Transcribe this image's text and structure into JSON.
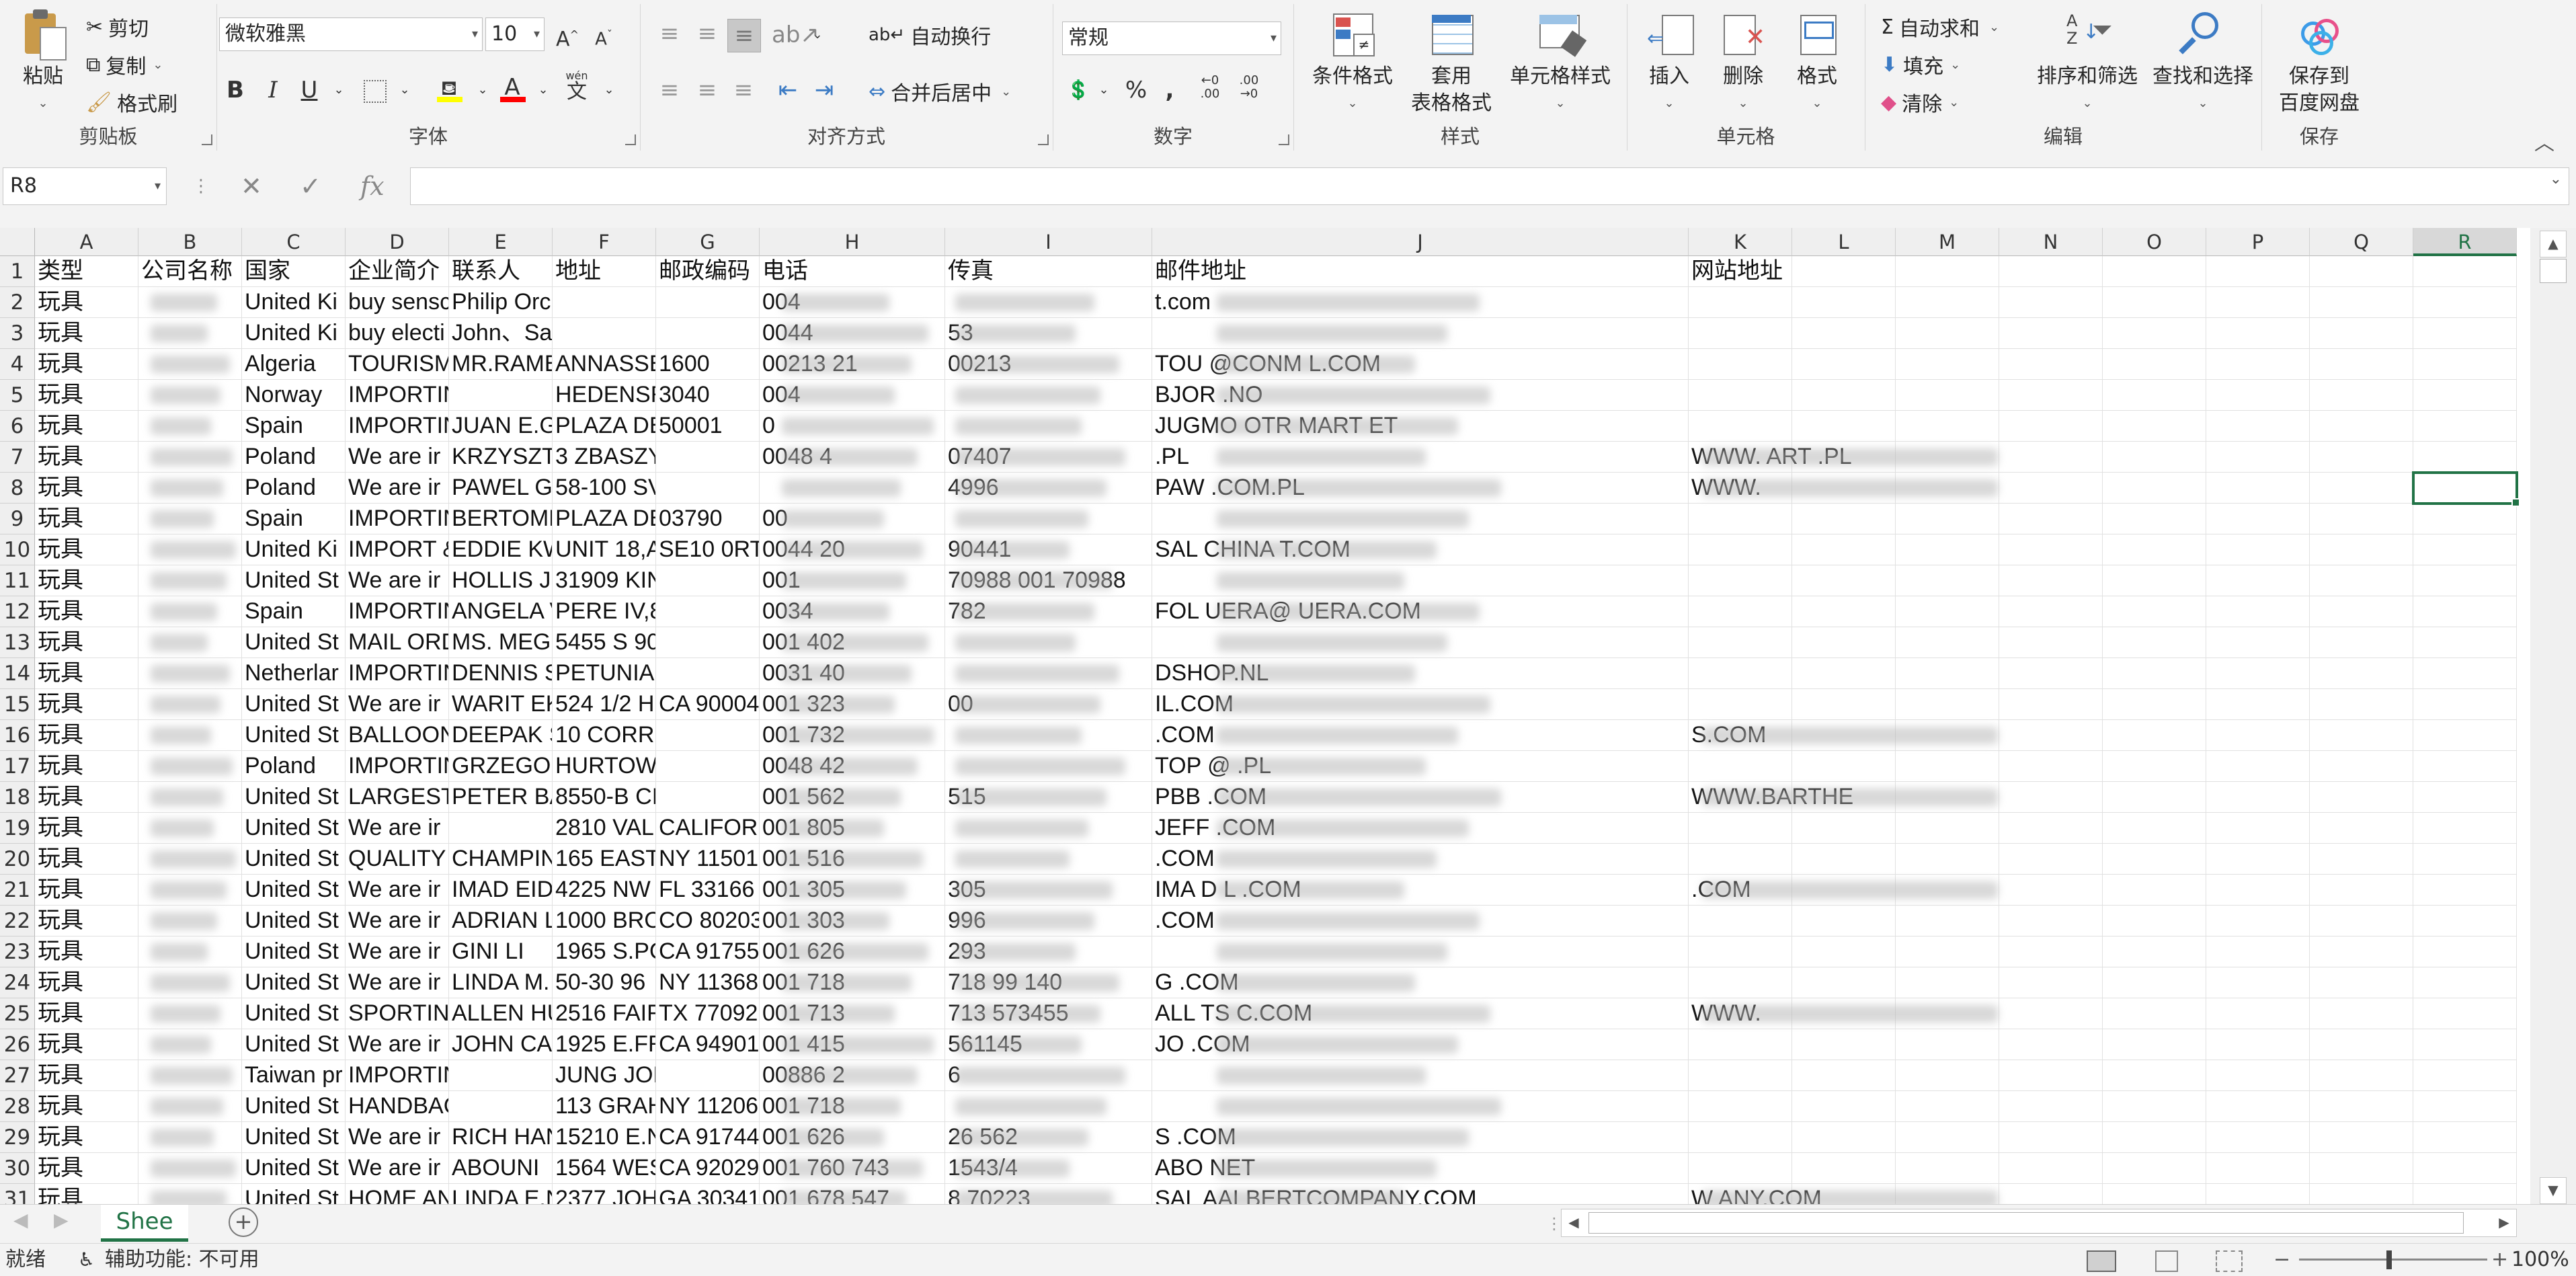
{
  "ribbon": {
    "clipboard": {
      "group_label": "剪贴板",
      "paste": "粘贴",
      "cut": "剪切",
      "copy": "复制",
      "format_painter": "格式刷"
    },
    "font": {
      "group_label": "字体",
      "font_name": "微软雅黑",
      "font_size": "10",
      "bold": "B",
      "italic": "I",
      "underline": "U",
      "grow": "A",
      "shrink": "A",
      "phonetic": "wén"
    },
    "alignment": {
      "group_label": "对齐方式",
      "wrap_text": "自动换行",
      "merge_center": "合并后居中"
    },
    "number": {
      "group_label": "数字",
      "format": "常规",
      "percent": "%",
      "comma": ","
    },
    "styles": {
      "group_label": "样式",
      "conditional": "条件格式",
      "table_format_1": "套用",
      "table_format_2": "表格格式",
      "cell_styles": "单元格样式"
    },
    "cells": {
      "group_label": "单元格",
      "insert": "插入",
      "delete": "删除",
      "format": "格式"
    },
    "editing": {
      "group_label": "编辑",
      "autosum": "自动求和",
      "fill": "填充",
      "clear": "清除",
      "sort_filter": "排序和筛选",
      "find_select": "查找和选择"
    },
    "save": {
      "group_label": "保存",
      "save_to_1": "保存到",
      "save_to_2": "百度网盘"
    }
  },
  "formula_bar": {
    "name_box": "R8",
    "fx": "fx",
    "content": ""
  },
  "columns": [
    "A",
    "B",
    "C",
    "D",
    "E",
    "F",
    "G",
    "H",
    "I",
    "J",
    "K",
    "L",
    "M",
    "N",
    "O",
    "P",
    "Q",
    "R"
  ],
  "selected_column": "R",
  "active_cell": "R8",
  "header_row": [
    "类型",
    "公司名称",
    "国家",
    "企业简介",
    "联系人",
    "地址",
    "邮政编码",
    "电话",
    "传真",
    "邮件地址",
    "网站地址"
  ],
  "rows": [
    {
      "n": "2",
      "A": "玩具",
      "C": "United Ki",
      "D": "buy sensc",
      "E": "Philip Orchard",
      "H": "004",
      "J": "t.com"
    },
    {
      "n": "3",
      "A": "玩具",
      "C": "United Ki",
      "D": "buy electi",
      "E": "John、Sandra Emms",
      "H": "0044",
      "I": "53",
      "J": ""
    },
    {
      "n": "4",
      "A": "玩具",
      "C": "Algeria",
      "D": "TOURISM",
      "E": "MR.RAME",
      "F": "ANNASSE",
      "G": "1600",
      "H": "00213 21",
      "I": "00213",
      "J": "TOU   @CONM   L.COM"
    },
    {
      "n": "5",
      "A": "玩具",
      "C": "Norway",
      "D": "IMPORTIN",
      "F": "HEDENSR",
      "G": "3040",
      "H": "004",
      "J": "BJOR                 .NO"
    },
    {
      "n": "6",
      "A": "玩具",
      "C": "Spain",
      "D": "IMPORTIN",
      "E": "JUAN E.G",
      "F": "PLAZA DE",
      "G": "50001",
      "H": "0",
      "J": "JUGMO  OTR    MART   ET"
    },
    {
      "n": "7",
      "A": "玩具",
      "C": "Poland",
      "D": "We are ir",
      "E": "KRZYSZT(",
      "F": "3 ZBASZY",
      "H": "0048 4",
      "I": "07407",
      "J": "                .PL",
      "K": "WWW.    ART    .PL"
    },
    {
      "n": "8",
      "A": "玩具",
      "C": "Poland",
      "D": "We are ir",
      "E": "PAWEL G",
      "F": "58-100 SV",
      "I": "4996",
      "J": "PAW        .COM.PL",
      "K": "WWW."
    },
    {
      "n": "9",
      "A": "玩具",
      "C": "Spain",
      "D": "IMPORTIN",
      "E": "BERTOME",
      "F": "PLAZA DE",
      "G": "03790",
      "H": "00",
      "J": ""
    },
    {
      "n": "10",
      "A": "玩具",
      "C": "United Ki",
      "D": "IMPORT &",
      "E": "EDDIE KW",
      "F": "UNIT 18,A",
      "G": "SE10 0RT",
      "H": "0044 20",
      "I": "90441",
      "J": "SAL    CHINA    T.COM"
    },
    {
      "n": "11",
      "A": "玩具",
      "C": "United St",
      "D": "We are ir",
      "E": "HOLLIS J.",
      "F": "31909 KIN",
      "H": "001",
      "I": "70988  001   70988",
      "J": ""
    },
    {
      "n": "12",
      "A": "玩具",
      "C": "Spain",
      "D": "IMPORTIN",
      "E": "ANGELA V",
      "F": "PERE IV,8",
      "H": "0034",
      "I": "782",
      "J": "FOL  UERA@     UERA.COM"
    },
    {
      "n": "13",
      "A": "玩具",
      "C": "United St",
      "D": "MAIL ORD",
      "E": "MS. MEG",
      "F": "5455 S 90",
      "H": "001 402",
      "J": ""
    },
    {
      "n": "14",
      "A": "玩具",
      "C": "Netherlar",
      "D": "IMPORTIN",
      "E": "DENNIS S",
      "F": "PETUNIAI",
      "H": "0031 40",
      "I": "",
      "J": "              DSHOP.NL"
    },
    {
      "n": "15",
      "A": "玩具",
      "C": "United St",
      "D": "We are ir",
      "E": "WARIT EK",
      "F": "524 1/2 H",
      "G": "CA 90004",
      "H": "001 323",
      "I": "00",
      "J": "                  IL.COM"
    },
    {
      "n": "16",
      "A": "玩具",
      "C": "United St",
      "D": "BALLOON",
      "E": "DEEPAK S",
      "F": "10 CORRI",
      "H": "001 732",
      "J": "                   .COM",
      "K": "                          S.COM"
    },
    {
      "n": "17",
      "A": "玩具",
      "C": "Poland",
      "D": "IMPORTIN",
      "E": "GRZEGOR",
      "F": "HURTOW",
      "H": "0048 42",
      "J": "TOP    @       .PL"
    },
    {
      "n": "18",
      "A": "玩具",
      "C": "United St",
      "D": "LARGEST",
      "E": "PETER BA",
      "F": "8550-B CI",
      "H": "001 562",
      "I": "515",
      "J": "PBB         .COM",
      "K": "WWW.BARTHE"
    },
    {
      "n": "19",
      "A": "玩具",
      "C": "United St",
      "D": "We are ir",
      "F": "2810 VAL",
      "G": "CALIFORN",
      "H": "001 805",
      "J": "JEFF         .COM"
    },
    {
      "n": "20",
      "A": "玩具",
      "C": "United St",
      "D": "QUALITY",
      "E": "CHAMPIN",
      "F": "165 EAST",
      "G": "NY 11501",
      "H": "001 516",
      "J": "              .COM"
    },
    {
      "n": "21",
      "A": "玩具",
      "C": "United St",
      "D": "We are ir",
      "E": "IMAD EID",
      "F": "4225 NW",
      "G": "FL 33166",
      "H": "001 305",
      "I": "305",
      "J": "IMA    D    L    .COM",
      "K": "                  .COM"
    },
    {
      "n": "22",
      "A": "玩具",
      "C": "United St",
      "D": "We are ir",
      "E": "ADRIAN L",
      "F": "1000 BRO",
      "G": "CO 80203",
      "H": "001 303",
      "I": "996",
      "J": "                  .COM"
    },
    {
      "n": "23",
      "A": "玩具",
      "C": "United St",
      "D": "We are ir",
      "E": "GINI LI",
      "F": "1965 S.PC",
      "G": "CA 91755",
      "H": "001 626",
      "I": "293",
      "J": ""
    },
    {
      "n": "24",
      "A": "玩具",
      "C": "United St",
      "D": "We are ir",
      "E": "LINDA M.",
      "F": "50-30 96",
      "G": "NY 11368",
      "H": "001 718",
      "I": "718   99  140",
      "J": "G              .COM"
    },
    {
      "n": "25",
      "A": "玩具",
      "C": "United St",
      "D": "SPORTIN(",
      "E": "ALLEN HU",
      "F": "2516 FAIF",
      "G": "TX 77092",
      "H": "001 713",
      "I": "713   573455",
      "J": "ALL            TS   C.COM",
      "K": "WWW."
    },
    {
      "n": "26",
      "A": "玩具",
      "C": "United St",
      "D": "We are ir",
      "E": "JOHN CA",
      "F": "1925 E.FR",
      "G": "CA 94901",
      "H": "001 415",
      "I": "561145",
      "J": "JO                  .COM"
    },
    {
      "n": "27",
      "A": "玩具",
      "C": "Taiwan pr",
      "D": "IMPORTIN",
      "F": "JUNG JON",
      "H": "00886 2",
      "I": "6",
      "J": ""
    },
    {
      "n": "28",
      "A": "玩具",
      "C": "United St",
      "D": "HANDBAG",
      "F": "113 GRAH",
      "G": "NY 11206",
      "H": "001 718",
      "J": ""
    },
    {
      "n": "29",
      "A": "玩具",
      "C": "United St",
      "D": "We are ir",
      "E": "RICH HAN",
      "F": "15210 E.N",
      "G": "CA 91744",
      "H": "001 626",
      "I": "26   562",
      "J": "           S        .COM"
    },
    {
      "n": "30",
      "A": "玩具",
      "C": "United St",
      "D": "We are ir",
      "E": "ABOUNI",
      "F": "1564 WES",
      "G": "CA 92029",
      "H": "001 760 743",
      "I": "1543/4",
      "J": "ABO             NET"
    },
    {
      "n": "31",
      "A": "玩具",
      "C": "United St",
      "D": "HOME AN",
      "E": "LINDA E.N",
      "F": "2377 JOH",
      "G": "GA 30341",
      "H": "001 678 547",
      "I": "8   70223",
      "J": "SAL          AALBERTCOMPANY.COM",
      "K": "W                            ANY.COM"
    }
  ],
  "sheet_tab": "Shee",
  "status": {
    "ready": "就绪",
    "accessibility": "辅助功能: 不可用",
    "zoom": "100%"
  },
  "colors": {
    "accent": "#217346",
    "selected_col_bg": "#d8d8d8"
  }
}
